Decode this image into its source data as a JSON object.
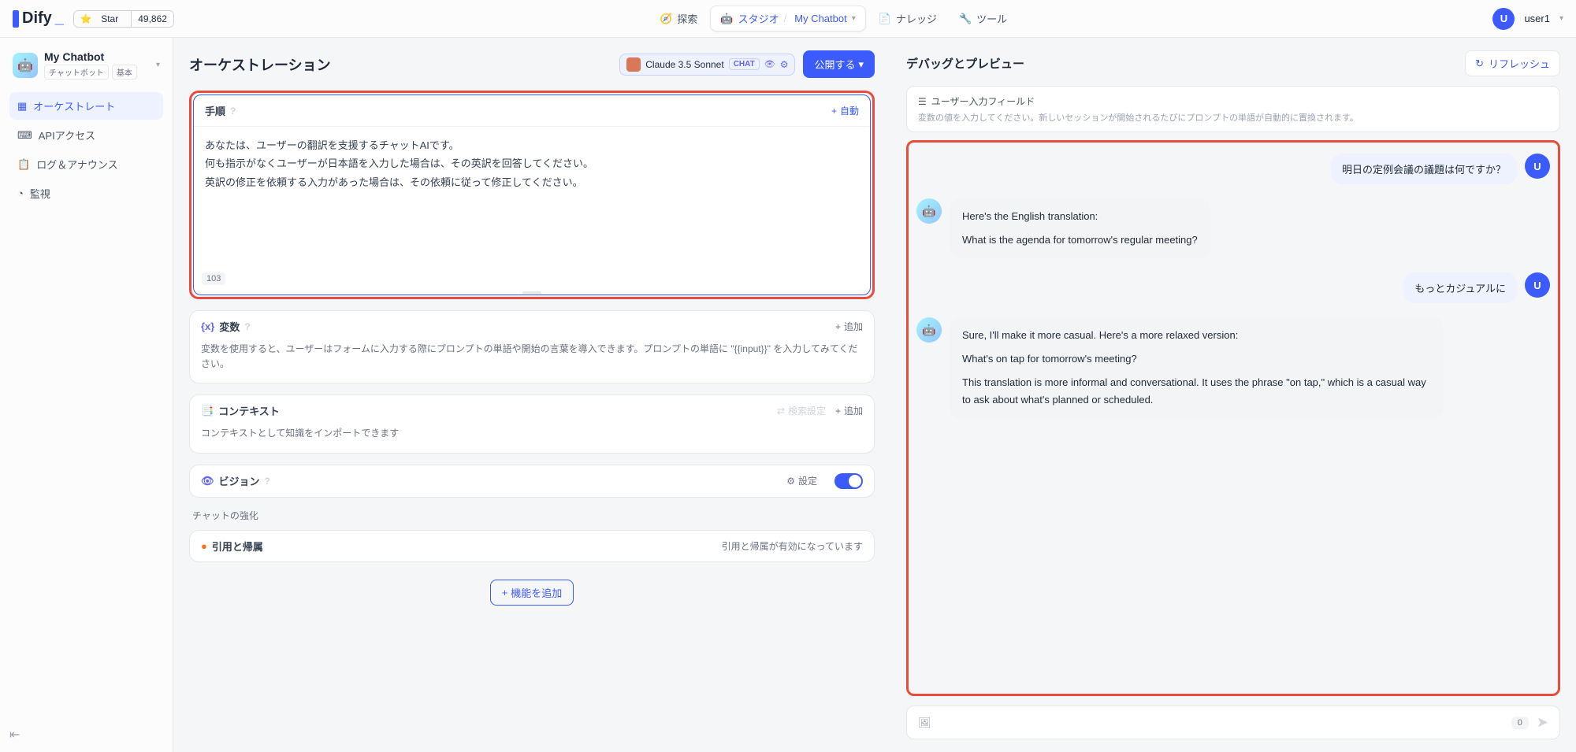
{
  "topbar": {
    "logo": "Dify",
    "github_star": "Star",
    "github_count": "49,862",
    "nav": {
      "explore": "探索",
      "studio": "スタジオ",
      "studio_sub": "My Chatbot",
      "knowledge": "ナレッジ",
      "tools": "ツール"
    },
    "user_initial": "U",
    "username": "user1"
  },
  "sidebar": {
    "app_name": "My Chatbot",
    "tag1": "チャットボット",
    "tag2": "基本",
    "items": {
      "orchestrate": "オーケストレート",
      "api": "APIアクセス",
      "logs": "ログ＆アナウンス",
      "monitor": "監視"
    }
  },
  "page": {
    "title": "オーケストレーション",
    "model_name": "Claude 3.5 Sonnet",
    "model_badge": "CHAT",
    "publish": "公開する"
  },
  "prompt": {
    "title": "手順",
    "auto_btn": "自動",
    "line1": "あなたは、ユーザーの翻訳を支援するチャットAIです。",
    "line2": "何も指示がなくユーザーが日本語を入力した場合は、その英訳を回答してください。",
    "line3": "英訳の修正を依頼する入力があった場合は、その依頼に従って修正してください。",
    "char_count": "103"
  },
  "variables": {
    "title": "変数",
    "add": "追加",
    "desc": "変数を使用すると、ユーザーはフォームに入力する際にプロンプトの単語や開始の言葉を導入できます。プロンプトの単語に \"{{input}}\" を入力してみてください。"
  },
  "context": {
    "title": "コンテキスト",
    "search_settings": "検索設定",
    "add": "追加",
    "desc": "コンテキストとして知識をインポートできます"
  },
  "vision": {
    "title": "ビジョン",
    "settings": "設定"
  },
  "chat_enhance": {
    "label": "チャットの強化",
    "citation_title": "引用と帰属",
    "citation_status": "引用と帰属が有効になっています"
  },
  "add_feature": "機能を追加",
  "preview": {
    "title": "デバッグとプレビュー",
    "refresh": "リフレッシュ",
    "input_fields_title": "ユーザー入力フィールド",
    "input_fields_desc": "変数の値を入力してください。新しいセッションが開始されるたびにプロンプトの単語が自動的に置換されます。"
  },
  "chat": {
    "msg1_user": "明日の定例会議の議題は何ですか？",
    "msg2_bot_l1": "Here's the English translation:",
    "msg2_bot_l2": "What is the agenda for tomorrow's regular meeting?",
    "msg3_user": "もっとカジュアルに",
    "msg4_bot_l1": "Sure, I'll make it more casual. Here's a more relaxed version:",
    "msg4_bot_l2": "What's on tap for tomorrow's meeting?",
    "msg4_bot_l3": "This translation is more informal and conversational. It uses the phrase \"on tap,\" which is a casual way to ask about what's planned or scheduled.",
    "user_initial": "U",
    "input_count": "0"
  }
}
